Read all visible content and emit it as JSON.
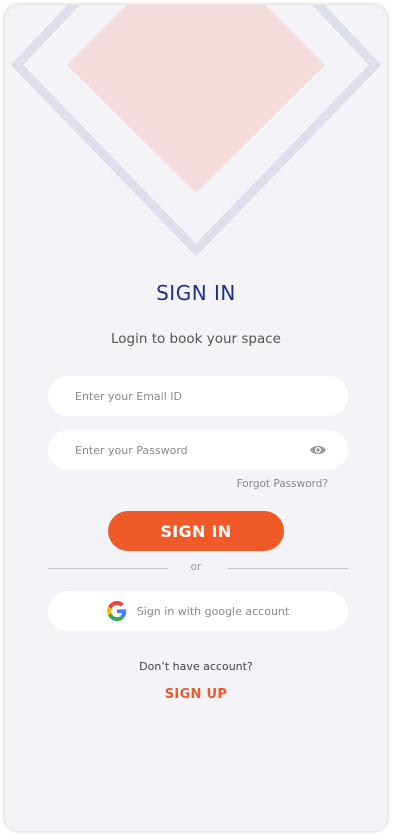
{
  "colors": {
    "background": "#f3f3f8",
    "title": "#1f2f8f",
    "accent": "#f05a28",
    "decor_outline": "#dde0ea",
    "decor_fill": "#f5dcdc"
  },
  "header": {
    "title": "SIGN IN",
    "subtitle": "Login to book your space"
  },
  "form": {
    "email_placeholder": "Enter your Email ID",
    "password_placeholder": "Enter your Password",
    "password_toggle_icon": "eye-icon",
    "forgot_password": "Forgot Password?",
    "submit_label": "SIGN IN"
  },
  "divider": {
    "label": "or"
  },
  "social": {
    "google_icon": "google-icon",
    "google_label": "Sign in with google account"
  },
  "footer": {
    "prompt": "Don’t have account?",
    "signup_label": "SIGN UP"
  }
}
